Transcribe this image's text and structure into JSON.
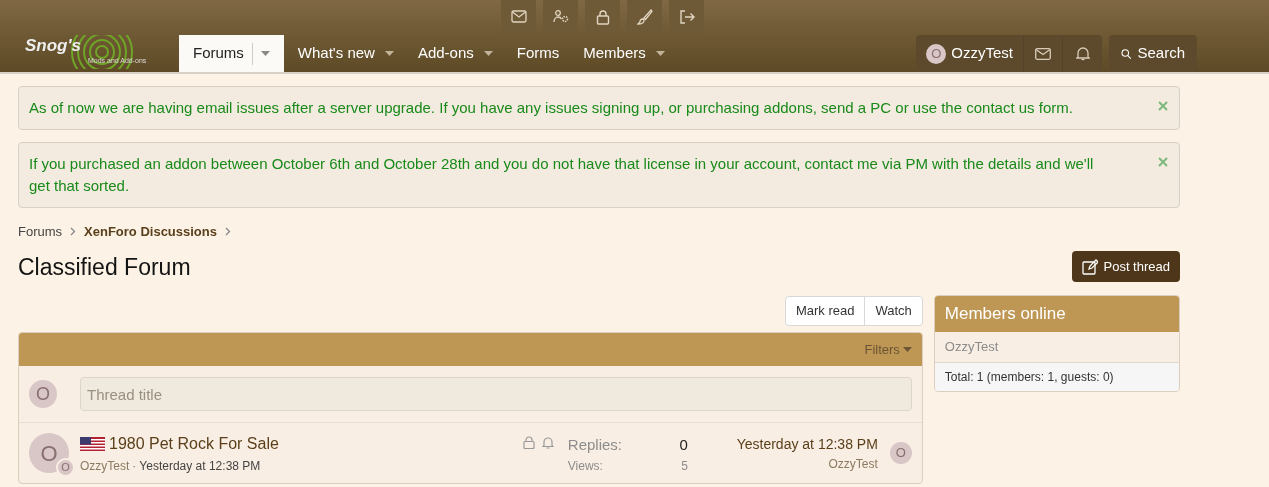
{
  "logo": {
    "title": "Snog's",
    "subtitle": "Mods and Add-ons"
  },
  "nav": {
    "tabs": [
      {
        "label": "Forums",
        "selected": true,
        "has_menu": true
      },
      {
        "label": "What's new",
        "selected": false,
        "has_menu": true
      },
      {
        "label": "Add-ons",
        "selected": false,
        "has_menu": true
      },
      {
        "label": "Forms",
        "selected": false,
        "has_menu": false
      },
      {
        "label": "Members",
        "selected": false,
        "has_menu": true
      }
    ],
    "user": {
      "avatar_letter": "O",
      "name": "OzzyTest"
    },
    "search": "Search"
  },
  "notices": [
    "As of now we are having email issues after a server upgrade. If you have any issues signing up, or purchasing addons, send a PC or use the contact us form.",
    "If you purchased an addon between October 6th and October 28th and you do not have that license in your account, contact me via PM with the details and we'll get that sorted."
  ],
  "breadcrumbs": [
    {
      "label": "Forums",
      "current": false
    },
    {
      "label": "XenForo Discussions",
      "current": true
    }
  ],
  "page_title": "Classified Forum",
  "post_thread": "Post thread",
  "actions": [
    "Mark read",
    "Watch"
  ],
  "block": {
    "filters": "Filters",
    "new_thread": {
      "avatar_letter": "O",
      "placeholder": "Thread title"
    },
    "threads": [
      {
        "avatar_letter": "O",
        "badge_letter": "O",
        "title": "1980 Pet Rock For Sale",
        "author": "OzzyTest",
        "separator": "·",
        "date": "Yesterday at 12:38 PM",
        "locked": true,
        "watched": true,
        "replies_label": "Replies:",
        "replies": "0",
        "views_label": "Views:",
        "views": "5",
        "last_date": "Yesterday at 12:38 PM",
        "last_user": "OzzyTest",
        "last_avatar_letter": "O"
      }
    ]
  },
  "sidebar": {
    "title": "Members online",
    "members": [
      "OzzyTest"
    ],
    "total": "Total: 1 (members: 1, guests: 0)"
  }
}
